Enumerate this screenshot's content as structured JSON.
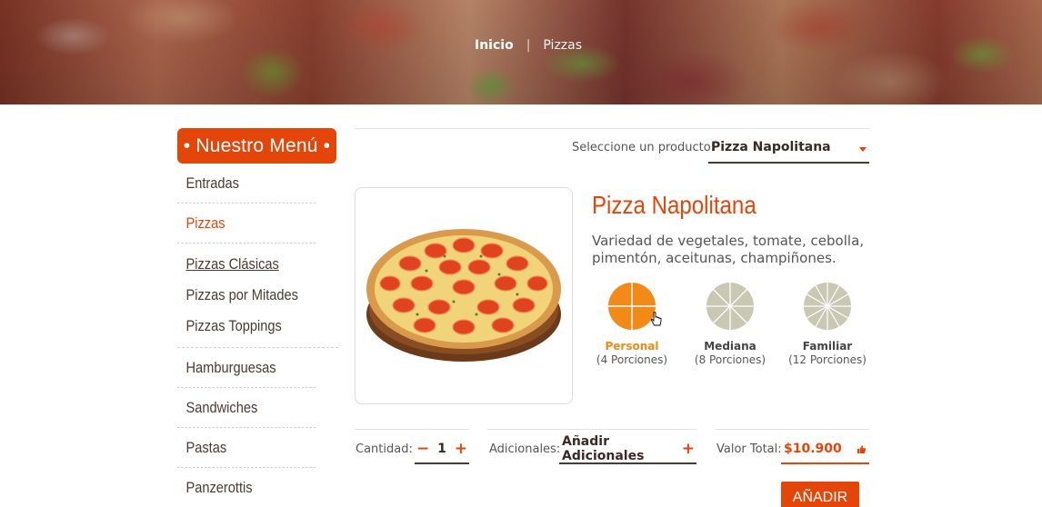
{
  "breadcrumb": {
    "home": "Inicio",
    "separator": "|",
    "current": "Pizzas"
  },
  "sidebar": {
    "title": "• Nuestro Menú •",
    "items": [
      {
        "label": "Entradas"
      },
      {
        "label": "Pizzas",
        "active": true
      },
      {
        "label": "Hamburguesas"
      },
      {
        "label": "Sandwiches"
      },
      {
        "label": "Pastas"
      },
      {
        "label": "Panzerottis"
      }
    ],
    "pizza_subitems": [
      {
        "label": "Pizzas Clásicas",
        "current": true
      },
      {
        "label": "Pizzas por Mitades"
      },
      {
        "label": "Pizzas Toppings"
      }
    ]
  },
  "product_select": {
    "label": "Seleccione un producto:",
    "value": "Pizza Napolitana"
  },
  "product": {
    "name": "Pizza Napolitana",
    "description": "Variedad de vegetales, tomate, cebolla, pimentón, aceitunas, champiñones."
  },
  "sizes": [
    {
      "name": "Personal",
      "portions": "(4 Porciones)",
      "selected": true
    },
    {
      "name": "Mediana",
      "portions": "(8 Porciones)",
      "selected": false
    },
    {
      "name": "Familiar",
      "portions": "(12 Porciones)",
      "selected": false
    }
  ],
  "order": {
    "quantity_label": "Cantidad:",
    "quantity": "1",
    "minus": "−",
    "plus": "+",
    "extras_label": "Adicionales:",
    "extras_value": "Añadir Adicionales",
    "total_label": "Valor Total:",
    "total": "$10.900",
    "add_button": "AÑADIR"
  },
  "colors": {
    "accent": "#e4460a",
    "selected_size": "#f08a17",
    "text_dark": "#4a3a33"
  }
}
